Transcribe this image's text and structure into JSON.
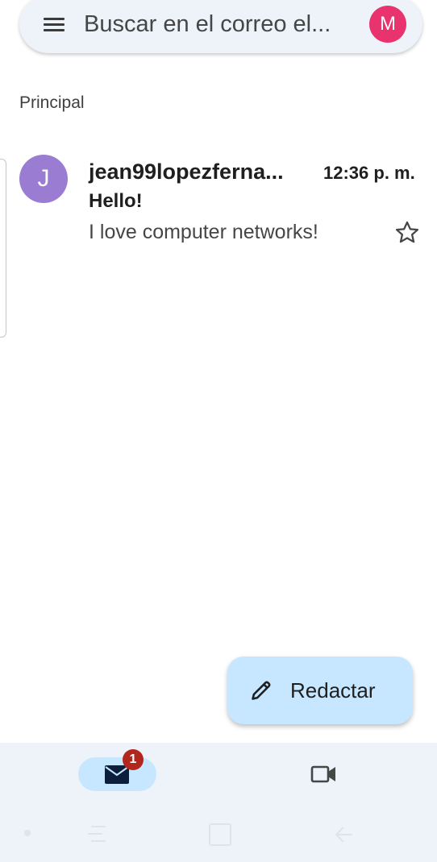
{
  "search": {
    "placeholder": "Buscar en el correo el...",
    "account_initial": "M"
  },
  "section": {
    "label": "Principal"
  },
  "emails": [
    {
      "avatar_initial": "J",
      "sender": "jean99lopezferna...",
      "time": "12:36 p. m.",
      "subject": "Hello!",
      "snippet": "I love computer networks!",
      "starred": false
    }
  ],
  "fab": {
    "label": "Redactar",
    "icon": "pencil-icon"
  },
  "bottom_nav": {
    "mail_badge": "1",
    "items": [
      "mail-icon",
      "video-camera-icon"
    ]
  },
  "colors": {
    "account_avatar": "#e8336f",
    "sender_avatar": "#9b7cd3",
    "fab_background": "#c6e7ff",
    "badge": "#b3261e",
    "nav_background": "#eef2f9"
  }
}
